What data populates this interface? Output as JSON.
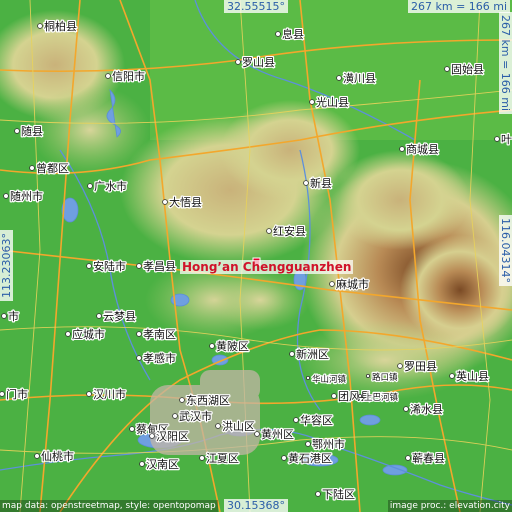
{
  "map": {
    "place_name": "Hong’an Chengguanzhen",
    "colors": {
      "lowland": "#3dac3a",
      "hills": "#cfd08e",
      "mountain": "#8a5a33",
      "water": "#6f9fe0",
      "road": "#f3a72c",
      "marker": "#e3002b",
      "coord_text": "#2b5ea8"
    },
    "coords": {
      "top_lat": "32.55515°",
      "bottom_lat": "30.15368°",
      "left_lon": "113.23063°",
      "right_lon": "116.04314°",
      "scale_top": "267 km = 166 mi",
      "scale_right": "267 km = 166 mi"
    },
    "credits": {
      "left": "map data: openstreetmap, style: opentopomap",
      "right": "image proc.: elevation.city"
    },
    "cities": [
      {
        "id": "tongbai",
        "name": "桐柏县",
        "small": false
      },
      {
        "id": "xixian",
        "name": "息县",
        "small": false
      },
      {
        "id": "luoshan",
        "name": "罗山县",
        "small": false
      },
      {
        "id": "xinyang",
        "name": "信阳市",
        "small": false
      },
      {
        "id": "huangchuan",
        "name": "潢川县",
        "small": false
      },
      {
        "id": "gushi",
        "name": "固始县",
        "small": false
      },
      {
        "id": "guangshan",
        "name": "光山县",
        "small": false
      },
      {
        "id": "suixian",
        "name": "随县",
        "small": false
      },
      {
        "id": "shangcheng",
        "name": "商城县",
        "small": false
      },
      {
        "id": "zengdu",
        "name": "曾都区",
        "small": false
      },
      {
        "id": "ye",
        "name": "叶",
        "small": false
      },
      {
        "id": "guangshui",
        "name": "广水市",
        "small": false
      },
      {
        "id": "xinxian",
        "name": "新县",
        "small": false
      },
      {
        "id": "suizhou",
        "name": "随州市",
        "small": false
      },
      {
        "id": "dawu",
        "name": "大悟县",
        "small": false
      },
      {
        "id": "hongan",
        "name": "红安县",
        "small": false
      },
      {
        "id": "anlu",
        "name": "安陆市",
        "small": false
      },
      {
        "id": "xiaochang",
        "name": "孝昌县",
        "small": false
      },
      {
        "id": "macheng",
        "name": "麻城市",
        "small": false
      },
      {
        "id": "shi",
        "name": "市",
        "small": false
      },
      {
        "id": "yunmeng",
        "name": "云梦县",
        "small": false
      },
      {
        "id": "xiaonan",
        "name": "孝南区",
        "small": false
      },
      {
        "id": "huangpi",
        "name": "黄陂区",
        "small": false
      },
      {
        "id": "yingcheng",
        "name": "应城市",
        "small": false
      },
      {
        "id": "xiaogan",
        "name": "孝感市",
        "small": false
      },
      {
        "id": "xinzhou",
        "name": "新洲区",
        "small": false
      },
      {
        "id": "luotian",
        "name": "罗田县",
        "small": false
      },
      {
        "id": "hanchuan",
        "name": "汉川市",
        "small": false
      },
      {
        "id": "dongxihu",
        "name": "东西湖区",
        "small": false
      },
      {
        "id": "huanggang",
        "name": "英山县",
        "small": false
      },
      {
        "id": "menshi",
        "name": "门市",
        "small": false
      },
      {
        "id": "tuanfeng",
        "name": "团风县",
        "small": false
      },
      {
        "id": "wuhan",
        "name": "武汉市",
        "small": false
      },
      {
        "id": "caidian",
        "name": "蔡甸区",
        "small": false
      },
      {
        "id": "hongshan",
        "name": "洪山区",
        "small": false
      },
      {
        "id": "huarong",
        "name": "华容区",
        "small": false
      },
      {
        "id": "hanyang",
        "name": "汉阳区",
        "small": false
      },
      {
        "id": "xishui",
        "name": "浠水县",
        "small": false
      },
      {
        "id": "ezhou",
        "name": "鄂州市",
        "small": false
      },
      {
        "id": "xiantao",
        "name": "仙桃市",
        "small": false
      },
      {
        "id": "hannan",
        "name": "汉南区",
        "small": false
      },
      {
        "id": "jiangxia",
        "name": "江夏区",
        "small": false
      },
      {
        "id": "huangzhou",
        "name": "黄州区",
        "small": false
      },
      {
        "id": "xialu",
        "name": "下陆区",
        "small": false
      },
      {
        "id": "qichun",
        "name": "蕲春县",
        "small": false
      },
      {
        "id": "huangshigang",
        "name": "黄石港区",
        "small": false
      },
      {
        "id": "huashan",
        "name": "华山河镇",
        "small": true
      },
      {
        "id": "shangbahe",
        "name": "上巴河镇",
        "small": true
      },
      {
        "id": "lumiao",
        "name": "路口镇",
        "small": true
      }
    ]
  }
}
